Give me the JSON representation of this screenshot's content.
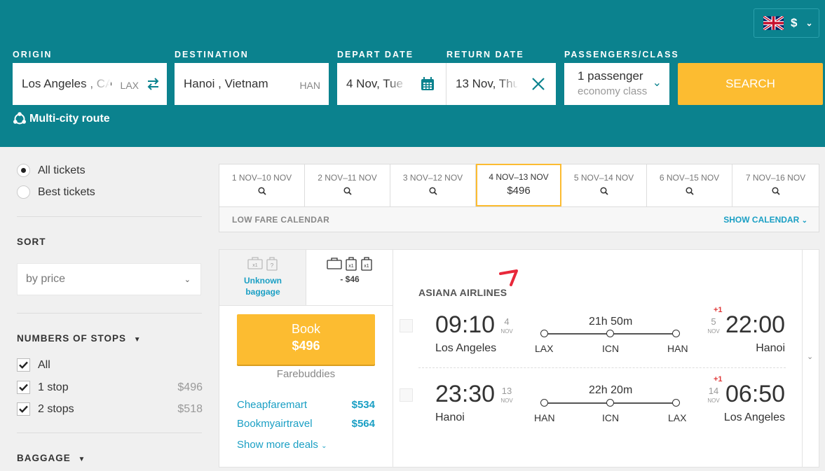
{
  "header": {
    "currency": "$",
    "labels": {
      "origin": "ORIGIN",
      "destination": "DESTINATION",
      "depart": "DEPART DATE",
      "return": "RETURN DATE",
      "passengers": "PASSENGERS/CLASS"
    },
    "origin": {
      "value": "Los Angeles , CA",
      "code": "LAX"
    },
    "destination": {
      "value": "Hanoi , Vietnam",
      "code": "HAN"
    },
    "depart": "4 Nov, Tue",
    "return": "13 Nov, Thu",
    "passengers": "1 passenger",
    "class": "economy class",
    "search_label": "SEARCH",
    "multi_city": "Multi-city route"
  },
  "sidebar": {
    "ticket_options": [
      "All tickets",
      "Best tickets"
    ],
    "selected_ticket_option": "All tickets",
    "sort_title": "SORT",
    "sort_value": "by price",
    "stops_title": "NUMBERS OF STOPS",
    "stops": [
      {
        "label": "All",
        "price": ""
      },
      {
        "label": "1 stop",
        "price": "$496"
      },
      {
        "label": "2 stops",
        "price": "$518"
      }
    ],
    "baggage_title": "BAGGAGE"
  },
  "dates": {
    "cells": [
      {
        "label": "1 NOV–10 NOV",
        "price": ""
      },
      {
        "label": "2 NOV–11 NOV",
        "price": ""
      },
      {
        "label": "3 NOV–12 NOV",
        "price": ""
      },
      {
        "label": "4 NOV–13 NOV",
        "price": "$496"
      },
      {
        "label": "5 NOV–14 NOV",
        "price": ""
      },
      {
        "label": "6 NOV–15 NOV",
        "price": ""
      },
      {
        "label": "7 NOV–16 NOV",
        "price": ""
      }
    ],
    "selected_index": 3,
    "low_fare": "LOW FARE CALENDAR",
    "show_calendar": "SHOW CALENDAR"
  },
  "result": {
    "baggage_unknown": "Unknown baggage",
    "baggage_price": "- $46",
    "bag_count_label": "x1",
    "book_label": "Book",
    "book_price": "$496",
    "agent": "Farebuddies",
    "deals": [
      {
        "name": "Cheapfaremart",
        "price": "$534"
      },
      {
        "name": "Bookmyairtravel",
        "price": "$564"
      }
    ],
    "show_more": "Show more deals",
    "airline": "ASIANA AIRLINES",
    "legs": [
      {
        "depart_time": "09:10",
        "depart_day": "4",
        "depart_month": "NOV",
        "depart_city": "Los Angeles",
        "duration": "21h 50m",
        "airports": [
          "LAX",
          "ICN",
          "HAN"
        ],
        "arrive_time": "22:00",
        "arrive_day": "5",
        "arrive_month": "NOV",
        "arrive_city": "Hanoi",
        "plus": "+1"
      },
      {
        "depart_time": "23:30",
        "depart_day": "13",
        "depart_month": "NOV",
        "depart_city": "Hanoi",
        "duration": "22h 20m",
        "airports": [
          "HAN",
          "ICN",
          "LAX"
        ],
        "arrive_time": "06:50",
        "arrive_day": "14",
        "arrive_month": "NOV",
        "arrive_city": "Los Angeles",
        "plus": "+1"
      }
    ]
  },
  "colors": {
    "header_bg": "#0b828e",
    "accent_yellow": "#fcbc31",
    "link_blue": "#1a9fc4",
    "plus_red": "#e03a3a"
  }
}
